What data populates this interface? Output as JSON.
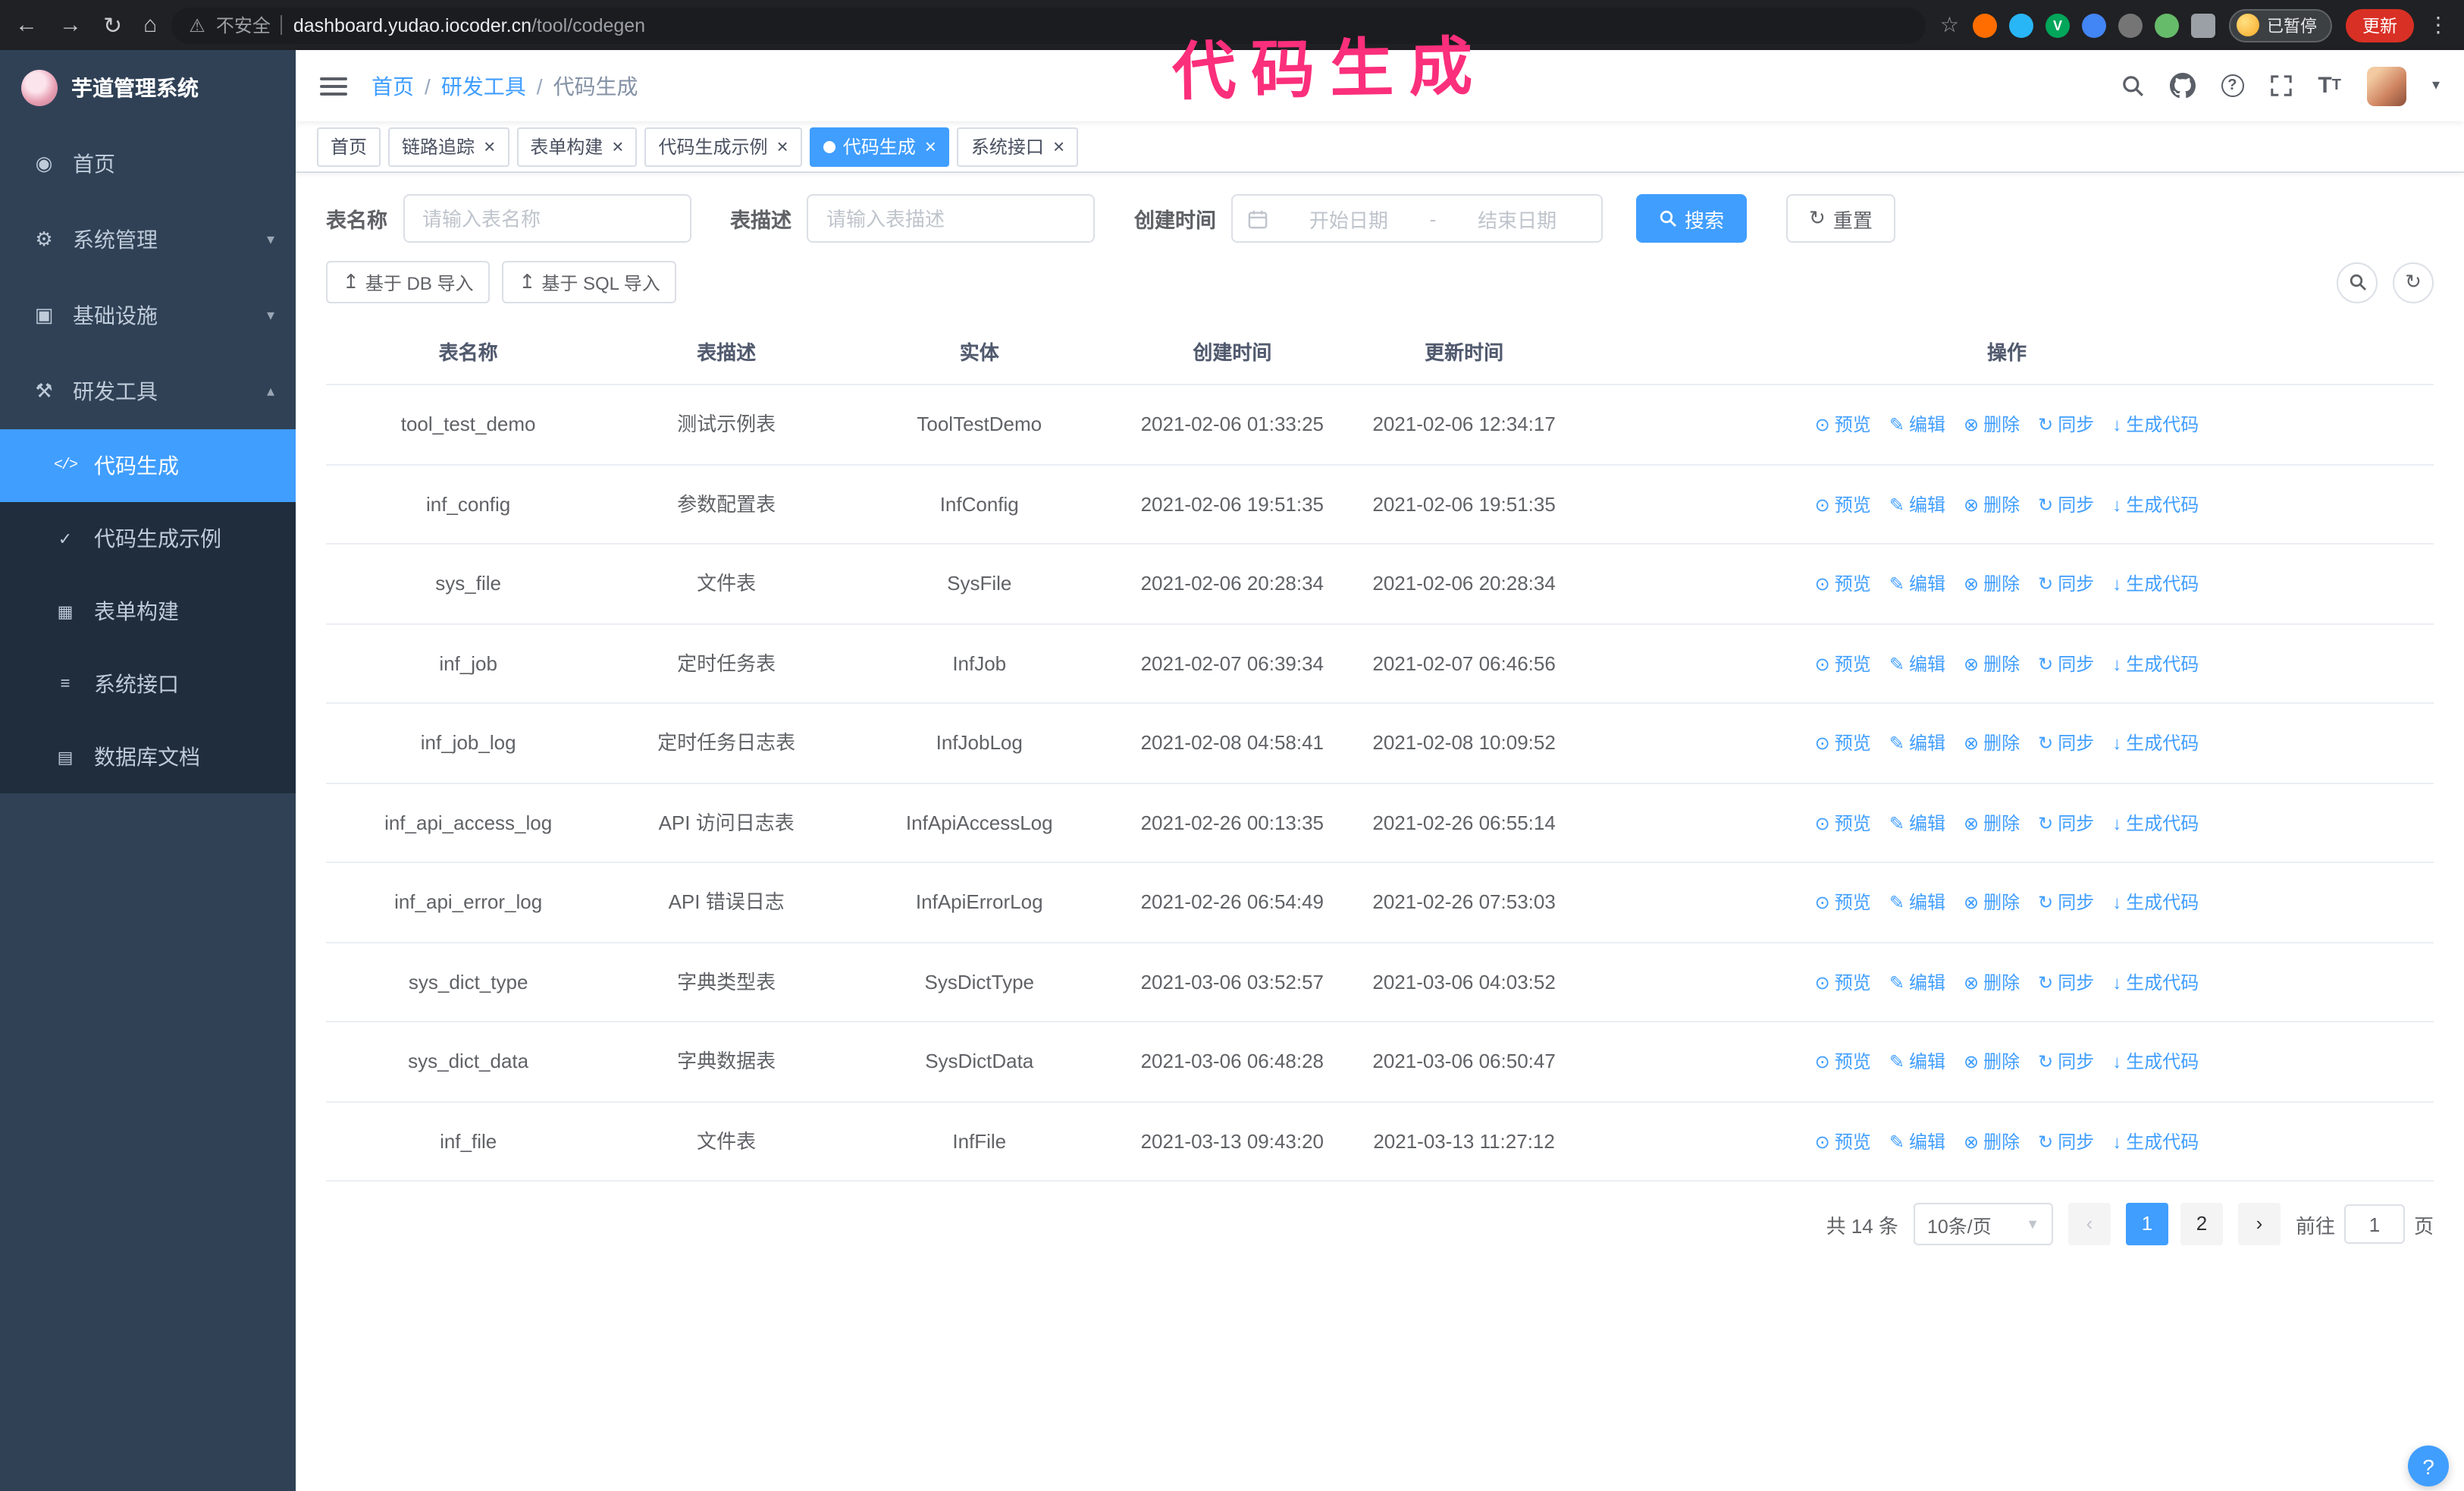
{
  "chrome": {
    "security_label": "不安全",
    "url_host": "dashboard.yudao.iocoder.cn",
    "url_path": "/tool/codegen",
    "paused_badge": "已暂停",
    "update_button": "更新",
    "extension_letter": "V"
  },
  "annotation": {
    "text": "代码生成",
    "color": "#fb2f7b"
  },
  "sidebar": {
    "logo_title": "芋道管理系统",
    "items": [
      {
        "label": "首页",
        "icon": "◉"
      },
      {
        "label": "系统管理",
        "icon": "⚙"
      },
      {
        "label": "基础设施",
        "icon": "▣"
      },
      {
        "label": "研发工具",
        "icon": "⚒"
      }
    ],
    "sub_items": [
      {
        "label": "代码生成",
        "icon": "</>"
      },
      {
        "label": "代码生成示例",
        "icon": "✓"
      },
      {
        "label": "表单构建",
        "icon": "▦"
      },
      {
        "label": "系统接口",
        "icon": "≡"
      },
      {
        "label": "数据库文档",
        "icon": "▤"
      }
    ]
  },
  "navbar": {
    "breadcrumb": [
      {
        "label": "首页"
      },
      {
        "label": "研发工具"
      },
      {
        "label": "代码生成"
      }
    ],
    "separator": "/"
  },
  "tabs": [
    {
      "id": "home",
      "label": "首页",
      "closable": false,
      "active": false
    },
    {
      "id": "trace",
      "label": "链路追踪",
      "closable": true,
      "active": false
    },
    {
      "id": "form-builder",
      "label": "表单构建",
      "closable": true,
      "active": false
    },
    {
      "id": "codegen-example",
      "label": "代码生成示例",
      "closable": true,
      "active": false
    },
    {
      "id": "codegen",
      "label": "代码生成",
      "closable": true,
      "active": true
    },
    {
      "id": "system-api",
      "label": "系统接口",
      "closable": true,
      "active": false
    }
  ],
  "filters": {
    "table_name_label": "表名称",
    "table_name_placeholder": "请输入表名称",
    "table_desc_label": "表描述",
    "table_desc_placeholder": "请输入表描述",
    "create_time_label": "创建时间",
    "start_date_placeholder": "开始日期",
    "range_separator": "-",
    "end_date_placeholder": "结束日期",
    "search_button": "搜索",
    "reset_button": "重置",
    "reset_icon": "↻"
  },
  "toolbar": {
    "import_db_button": "基于 DB 导入",
    "import_sql_button": "基于 SQL 导入",
    "import_icon": "↥",
    "refresh_icon": "↻"
  },
  "table": {
    "columns": [
      "表名称",
      "表描述",
      "实体",
      "创建时间",
      "更新时间",
      "操作"
    ],
    "row_actions": [
      {
        "id": "preview",
        "label": "预览",
        "icon": "⊙"
      },
      {
        "id": "edit",
        "label": "编辑",
        "icon": "✎"
      },
      {
        "id": "delete",
        "label": "删除",
        "icon": "⊗"
      },
      {
        "id": "sync",
        "label": "同步",
        "icon": "↻"
      },
      {
        "id": "generate-code",
        "label": "生成代码",
        "icon": "↓"
      }
    ],
    "rows": [
      {
        "name": "tool_test_demo",
        "desc": "测试示例表",
        "entity": "ToolTestDemo",
        "created": "2021-02-06 01:33:25",
        "updated": "2021-02-06 12:34:17"
      },
      {
        "name": "inf_config",
        "desc": "参数配置表",
        "entity": "InfConfig",
        "created": "2021-02-06 19:51:35",
        "updated": "2021-02-06 19:51:35"
      },
      {
        "name": "sys_file",
        "desc": "文件表",
        "entity": "SysFile",
        "created": "2021-02-06 20:28:34",
        "updated": "2021-02-06 20:28:34"
      },
      {
        "name": "inf_job",
        "desc": "定时任务表",
        "entity": "InfJob",
        "created": "2021-02-07 06:39:34",
        "updated": "2021-02-07 06:46:56"
      },
      {
        "name": "inf_job_log",
        "desc": "定时任务日志表",
        "entity": "InfJobLog",
        "created": "2021-02-08 04:58:41",
        "updated": "2021-02-08 10:09:52"
      },
      {
        "name": "inf_api_access_log",
        "desc": "API 访问日志表",
        "entity": "InfApiAccessLog",
        "created": "2021-02-26 00:13:35",
        "updated": "2021-02-26 06:55:14"
      },
      {
        "name": "inf_api_error_log",
        "desc": "API 错误日志",
        "entity": "InfApiErrorLog",
        "created": "2021-02-26 06:54:49",
        "updated": "2021-02-26 07:53:03"
      },
      {
        "name": "sys_dict_type",
        "desc": "字典类型表",
        "entity": "SysDictType",
        "created": "2021-03-06 03:52:57",
        "updated": "2021-03-06 04:03:52"
      },
      {
        "name": "sys_dict_data",
        "desc": "字典数据表",
        "entity": "SysDictData",
        "created": "2021-03-06 06:48:28",
        "updated": "2021-03-06 06:50:47"
      },
      {
        "name": "inf_file",
        "desc": "文件表",
        "entity": "InfFile",
        "created": "2021-03-13 09:43:20",
        "updated": "2021-03-13 11:27:12"
      }
    ]
  },
  "pagination": {
    "total": "共 14 条",
    "page_size": "10条/页",
    "pages": [
      "1",
      "2"
    ],
    "active_page": "1",
    "goto_label": "前往",
    "goto_value": "1",
    "goto_suffix": "页"
  },
  "fab_glyph": "?"
}
